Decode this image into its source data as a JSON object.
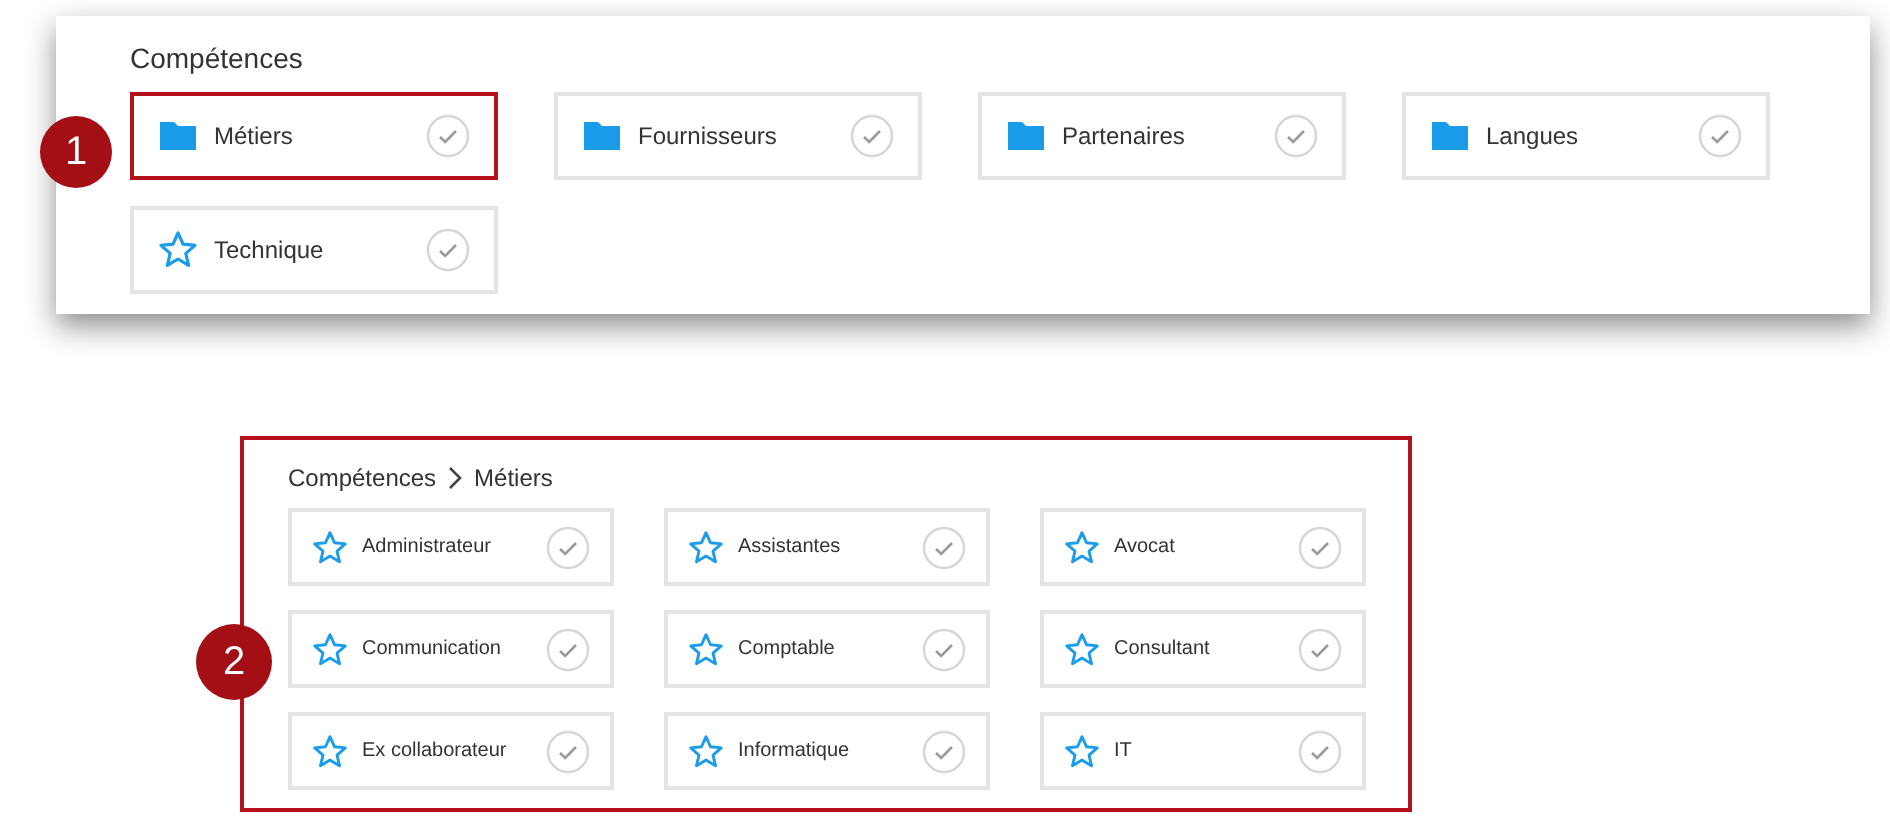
{
  "competences_panel": {
    "title": "Compétences",
    "items": [
      {
        "label": "Métiers",
        "kind": "folder",
        "highlighted": true
      },
      {
        "label": "Fournisseurs",
        "kind": "folder",
        "highlighted": false
      },
      {
        "label": "Partenaires",
        "kind": "folder",
        "highlighted": false
      },
      {
        "label": "Langues",
        "kind": "folder",
        "highlighted": false
      },
      {
        "label": "Technique",
        "kind": "star",
        "highlighted": false
      }
    ],
    "callout": "1"
  },
  "metiers_panel": {
    "breadcrumb": [
      "Compétences",
      "Métiers"
    ],
    "items": [
      {
        "label": "Administrateur",
        "kind": "star"
      },
      {
        "label": "Assistantes",
        "kind": "star"
      },
      {
        "label": "Avocat",
        "kind": "star"
      },
      {
        "label": "Communication",
        "kind": "star"
      },
      {
        "label": "Comptable",
        "kind": "star"
      },
      {
        "label": "Consultant",
        "kind": "star"
      },
      {
        "label": "Ex collaborateur",
        "kind": "star"
      },
      {
        "label": "Informatique",
        "kind": "star"
      },
      {
        "label": "IT",
        "kind": "star"
      }
    ],
    "callout": "2"
  }
}
